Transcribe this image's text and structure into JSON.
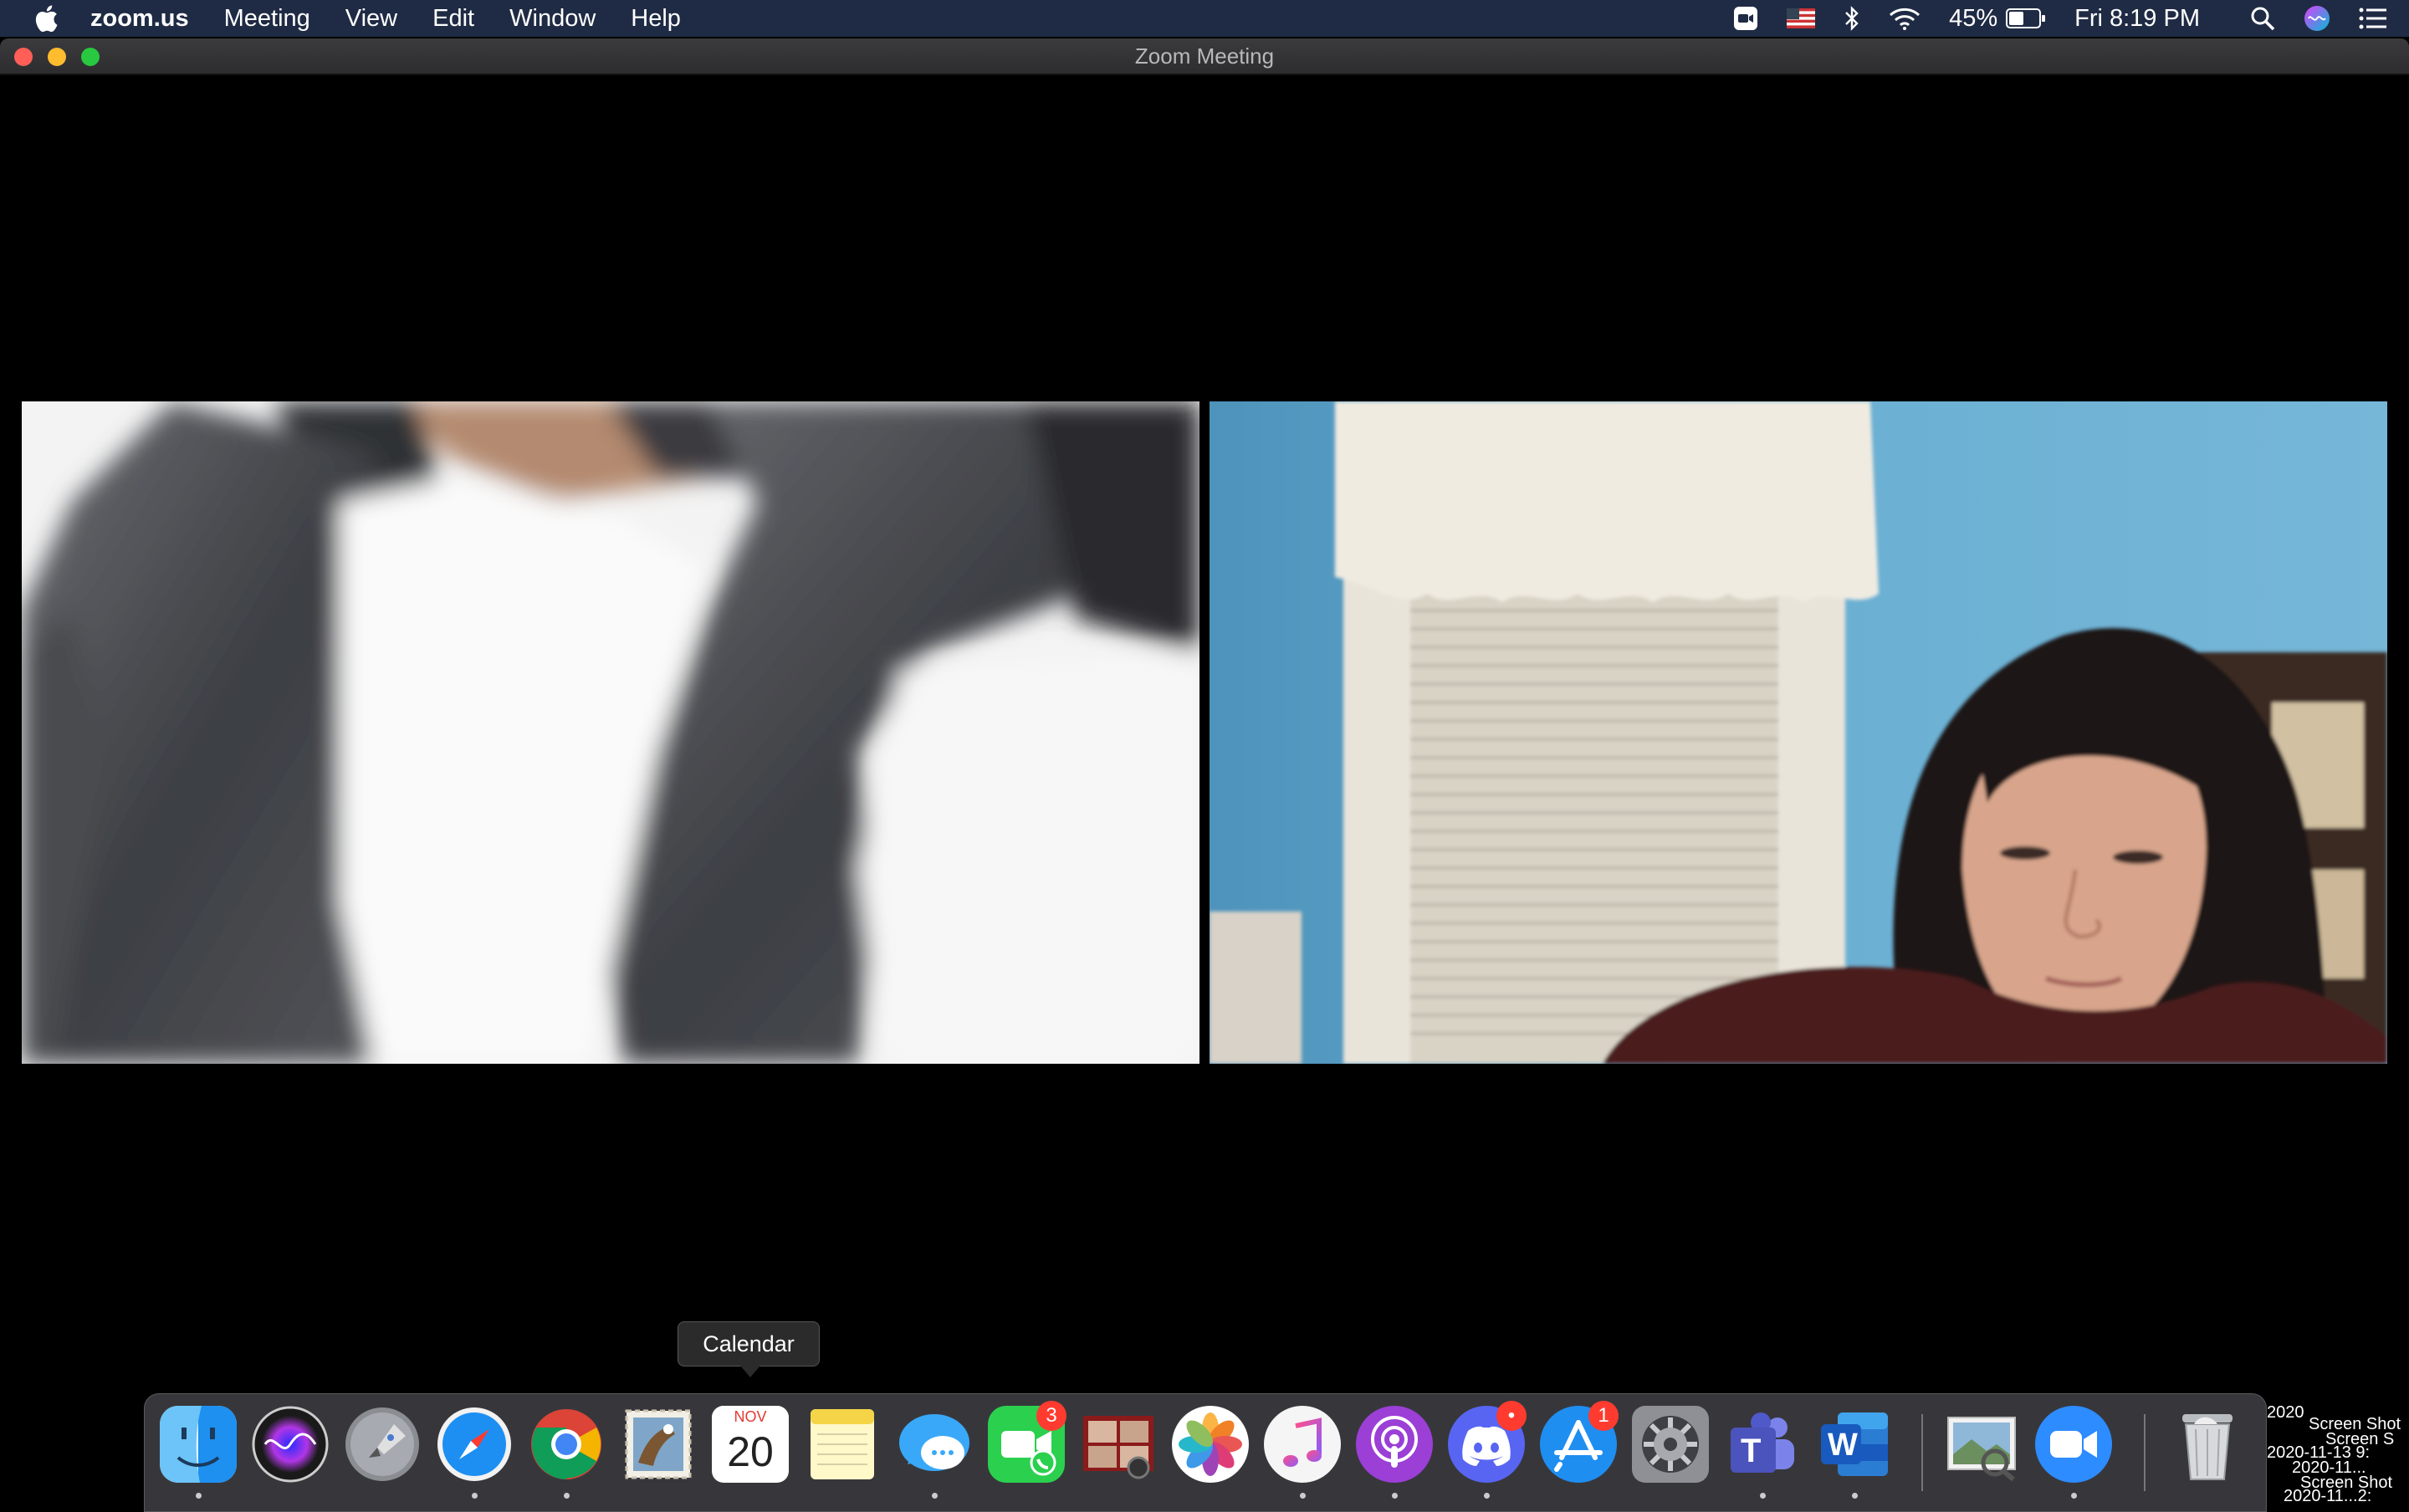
{
  "menubar": {
    "app_name": "zoom.us",
    "menus": [
      "Meeting",
      "View",
      "Edit",
      "Window",
      "Help"
    ],
    "battery_percent": "45%",
    "clock": "Fri 8:19 PM"
  },
  "window": {
    "title": "Zoom Meeting"
  },
  "tooltip": {
    "text": "Calendar"
  },
  "dock": {
    "calendar_month": "NOV",
    "calendar_day": "20",
    "facetime_badge": "3",
    "appstore_badge": "1",
    "teams_letter": "T",
    "word_letter": "W"
  },
  "desktop": {
    "file_labels": [
      "2020",
      "Screen Shot",
      "Screen S",
      "2020-11-13 9:",
      "2020-11...",
      "Screen Shot",
      "2020-11...2:"
    ]
  },
  "colors": {
    "menubar_bg": "#1f2b44",
    "window_bg": "#000000",
    "badge": "#ff3b30"
  }
}
